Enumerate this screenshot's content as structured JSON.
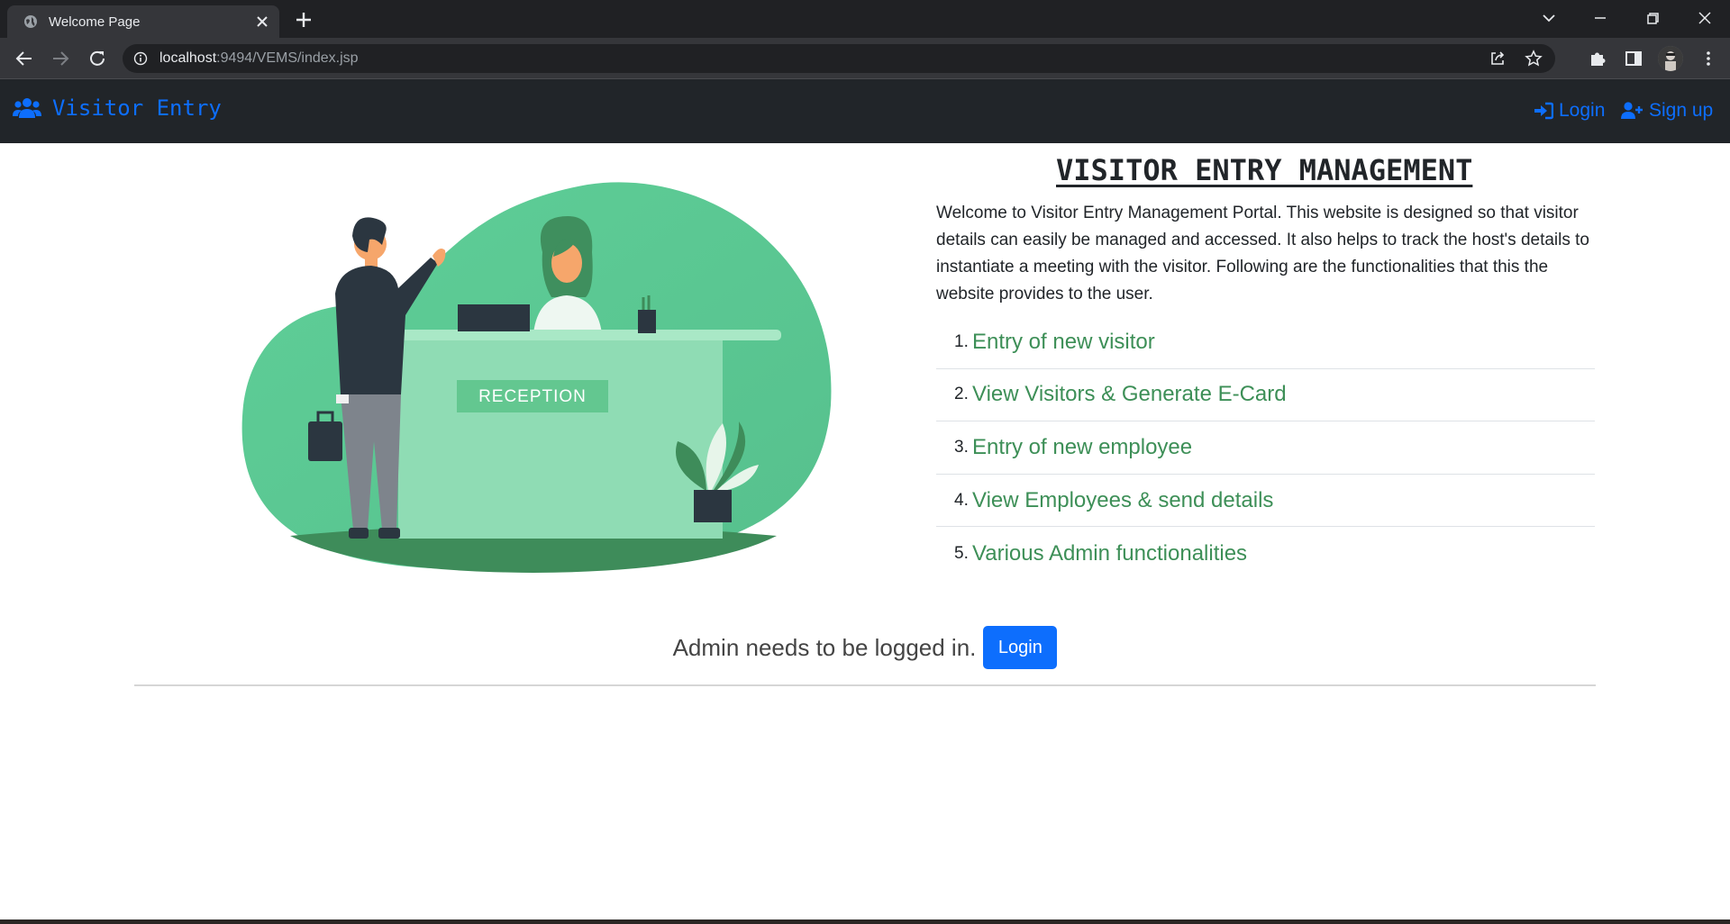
{
  "browser": {
    "tab_title": "Welcome Page",
    "url_host": "localhost",
    "url_path": ":9494/VEMS/index.jsp"
  },
  "navbar": {
    "brand": "Visitor Entry",
    "login_label": "Login",
    "signup_label": "Sign up",
    "accent": "#0d6efd",
    "background": "#212529"
  },
  "illustration": {
    "label": "RECEPTION"
  },
  "main": {
    "heading": "VISITOR ENTRY MANAGEMENT",
    "intro": "Welcome to Visitor Entry Management Portal. This website is designed so that visitor details can easily be managed and accessed. It also helps to track the host's details to instantiate a meeting with the visitor. Following are the functionalities that this the website provides to the user.",
    "functionalities": [
      {
        "num": "1.",
        "label": "Entry of new visitor"
      },
      {
        "num": "2.",
        "label": "View Visitors & Generate E-Card"
      },
      {
        "num": "3.",
        "label": "Entry of new employee"
      },
      {
        "num": "4.",
        "label": "View Employees & send details"
      },
      {
        "num": "5.",
        "label": "Various Admin functionalities"
      }
    ],
    "link_color": "#3d8f57"
  },
  "admin": {
    "notice": "Admin needs to be logged in.",
    "button_label": "Login"
  }
}
